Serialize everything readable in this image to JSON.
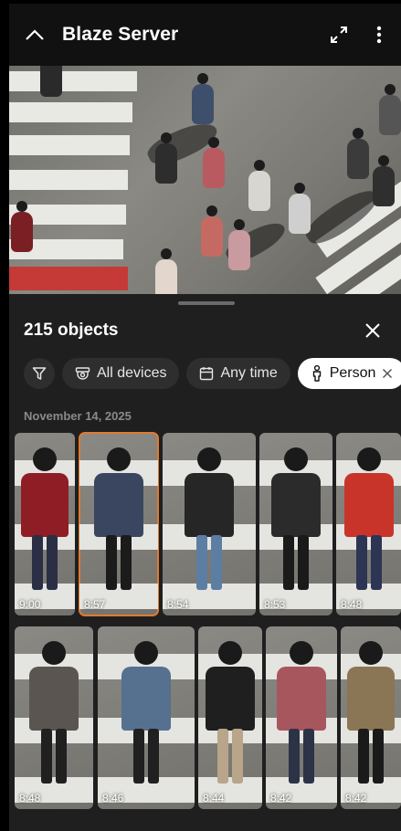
{
  "header": {
    "title": "Blaze Server"
  },
  "sheet": {
    "count_label": "215 objects",
    "date_label": "November 14, 2025",
    "chips": [
      {
        "label": "All devices",
        "icon": "camera-icon"
      },
      {
        "label": "Any time",
        "icon": "calendar-icon"
      },
      {
        "label": "Person",
        "icon": "person-icon"
      }
    ]
  },
  "tiles": [
    {
      "time": "9:00",
      "torso": "#8f1d26",
      "legs": "#2a2f45"
    },
    {
      "time": "8:57",
      "torso": "#3a4660",
      "legs": "#1b1b1b",
      "selected": true
    },
    {
      "time": "8:54",
      "torso": "#262626",
      "legs": "#5d7ea3"
    },
    {
      "time": "8:53",
      "torso": "#2b2b2b",
      "legs": "#1a1a1a"
    },
    {
      "time": "8:48",
      "torso": "#c9342a",
      "legs": "#2c3554"
    },
    {
      "time": "8:48",
      "torso": "#5a5550",
      "legs": "#202020"
    },
    {
      "time": "8:46",
      "torso": "#56708f",
      "legs": "#202020"
    },
    {
      "time": "8:44",
      "torso": "#1f1f1f",
      "legs": "#b8a58a"
    },
    {
      "time": "8:42",
      "torso": "#a8565e",
      "legs": "#2c3347"
    },
    {
      "time": "8:42",
      "torso": "#8a7555",
      "legs": "#1a1a1a"
    }
  ]
}
